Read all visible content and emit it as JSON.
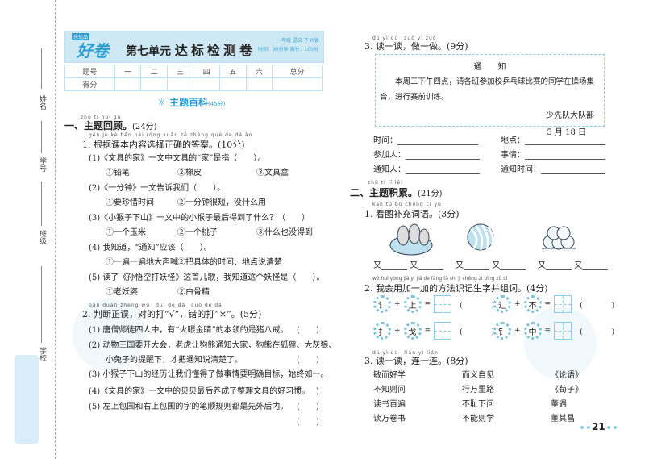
{
  "margin": {
    "labels": [
      "姓名",
      "学号",
      "班级",
      "学校"
    ]
  },
  "header": {
    "brand_tag": "乐优品",
    "logo": "好卷",
    "unit": "第七单元",
    "title": "达标检测卷",
    "grade_info": "一年级 语文 下 R版",
    "time_info": "时间：90分钟  满分：100分"
  },
  "score_table": {
    "row1": [
      "题号",
      "一",
      "二",
      "三",
      "四",
      "五",
      "六",
      "总分"
    ],
    "row2_label": "得分"
  },
  "section_banner": {
    "title": "主题百科",
    "score": "(45分)"
  },
  "part1": {
    "pinyin": "zhǔ tí huí gù",
    "title": "一、主题回顾。",
    "score": "(24分)",
    "q1": {
      "pinyin": "gēn jù kè běn nèi róng xuǎn zé zhèng què de dá àn",
      "title": "1. 根据课本内容选择正确的答案。",
      "score": "(10分)",
      "items": [
        {
          "q": "(1)《文具的家》一文中文具的“家”是指（　　）。",
          "opts": [
            "①铅笔",
            "②橡皮",
            "③文具盒"
          ]
        },
        {
          "q": "(2)《一分钟》一文告诉我们（　　）。",
          "opts": [
            "①要珍惜时间",
            "②一分钟很短，没什么用"
          ]
        },
        {
          "q": "(3)《小猴子下山》一文中的小猴子最后得到了什么？（　　）",
          "opts": [
            "①一个玉米",
            "②一个桃子",
            "③什么也没得到"
          ]
        },
        {
          "q": "(4) 我知道，“通知”应该（　　）。",
          "opts": [
            "①一遍一遍地大声喊",
            "②把具体的时间、地点说清楚"
          ]
        },
        {
          "q": "(5) 读了《孙悟空打妖怪》这首儿歌，我知道这个妖怪是（　　）。",
          "opts": [
            "①老妖婆",
            "②白骨精"
          ]
        }
      ]
    },
    "q2": {
      "pinyin": "pàn duàn zhèng wù　duì de dǎ　cuò de dǎ",
      "title": "2. 判断正误，对的打“√”，错的打“×”。",
      "score": "(5分)",
      "items": [
        "(1) 唐僧师徒四人中，有“火眼金睛”的本领的是猪八戒。",
        "(2) 动物王国要开大会，老虎让狗熊通知大家，狗熊在狐狸、大灰狼、",
        "小兔子的提醒下，才把通知说清楚了。",
        "(3) 小猴子下山的经历让我们懂得了做事情要明确目标，始终如一。",
        "(4)《文具的家》一文中的贝贝最后养成了整理文具的好习惯。",
        "(5) 左上包围和右上包围的字的笔顺规则都是先外后内。"
      ],
      "paren": "(　　)"
    },
    "q3": {
      "pinyin": "dú yì dú　zuò yì zuò",
      "title": "3. 读一读，做一做。",
      "score": "(9分)",
      "notice": {
        "title": "通　　知",
        "body": "本周三下午四点，请各班参加校乒乓球比赛的同学在操场集合，进行赛前训练。",
        "signer": "少先队大队部",
        "date": "5 月 18 日"
      },
      "fields": [
        "时间：",
        "地点：",
        "参加人：",
        "事情：",
        "通知人：",
        "通知时间："
      ]
    }
  },
  "part2": {
    "pinyin": "zhǔ tí jī lěi",
    "title": "二、主题积累。",
    "score": "(21分)",
    "q1": {
      "pinyin": "kàn tú bǔ chōng cí yǔ",
      "title": "1. 看图补充词语。",
      "score": "(3分)",
      "you": "又",
      "images": [
        "corn-image",
        "watermelon-image",
        "peaches-image"
      ]
    },
    "q2": {
      "pinyin": "wǒ huì yòng jiā yi jiā de fāng fǎ shí jì shēng zì bìng zǔ cí",
      "title": "2. 我会用加一加的方法识记生字并组词。",
      "score": "(4分)",
      "rows": [
        [
          "讠",
          "上"
        ],
        [
          "辶",
          "不"
        ],
        [
          "扌",
          "戈"
        ],
        [
          "钅",
          "中"
        ]
      ],
      "plus": "+",
      "eq": "="
    },
    "q3": {
      "pinyin": "dú yì dú　lián yì lián",
      "title": "3. 读一读，连一连。",
      "score": "(8分)",
      "col1": [
        "敏而好学",
        "不知则问",
        "读书百遍",
        "读万卷书"
      ],
      "col2": [
        "而义自见",
        "行万里路",
        "不耻下问",
        "不能则学"
      ],
      "col3": [
        "《论语》",
        "《荀子》",
        "董遇",
        "董其昌"
      ]
    }
  },
  "page_number": "21"
}
